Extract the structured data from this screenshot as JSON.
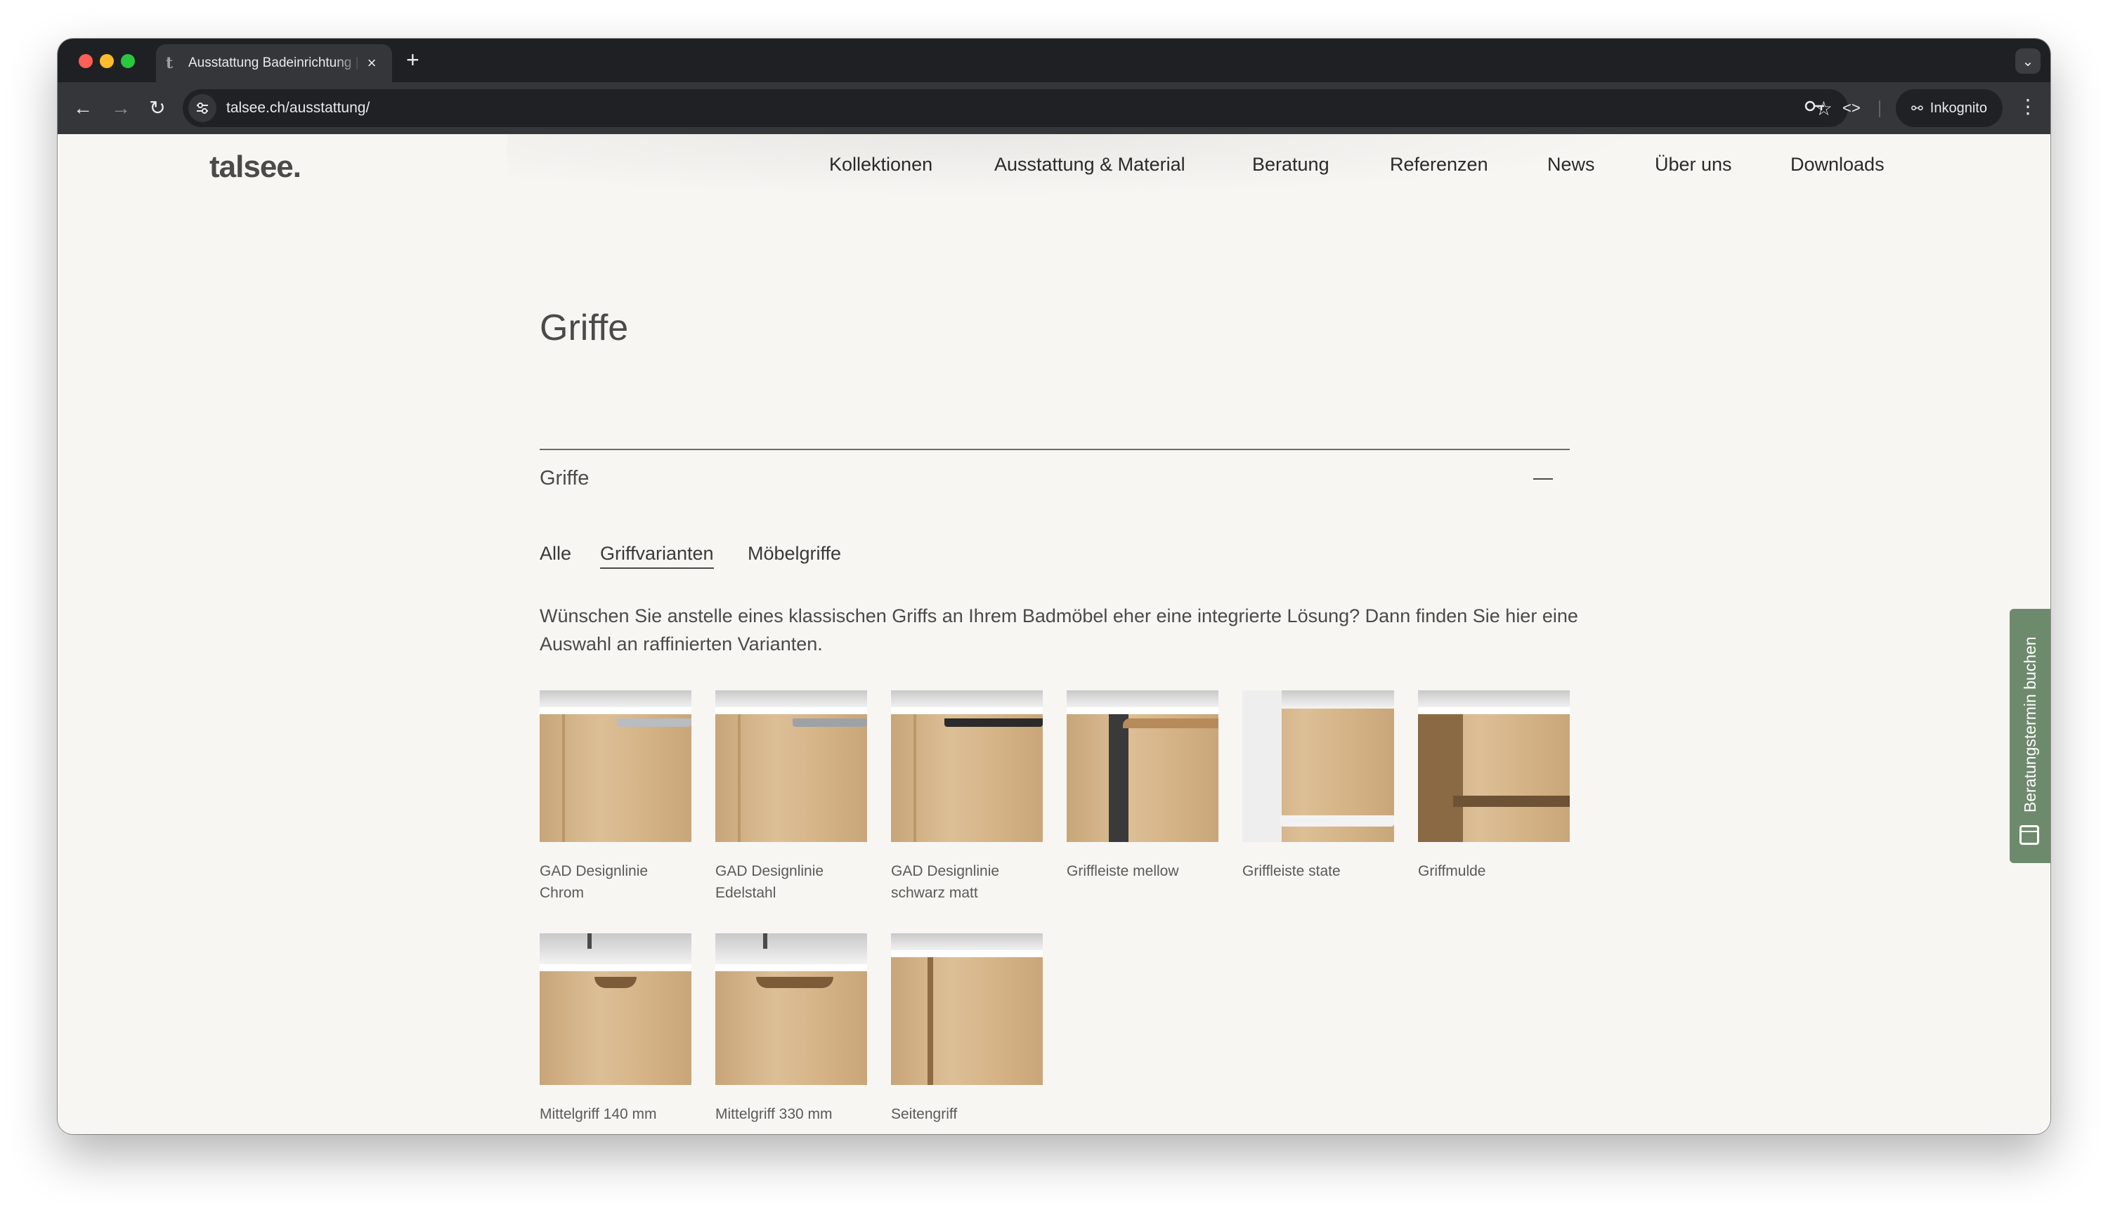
{
  "browser": {
    "tab_title": "Ausstattung Badeinrichtung |",
    "tab_favicon": "t",
    "new_tab_icon": "+",
    "close_icon": "×",
    "url": "talsee.ch/ausstattung/",
    "incognito_label": "Inkognito"
  },
  "site": {
    "logo": "talsee.",
    "nav": [
      "Kollektionen",
      "Ausstattung & Material",
      "Beratung",
      "Referenzen",
      "News",
      "Über uns",
      "Downloads"
    ]
  },
  "main": {
    "heading": "Griffe",
    "accordion_title": "Griffe",
    "filters": [
      {
        "label": "Alle",
        "active": false
      },
      {
        "label": "Griffvarianten",
        "active": true
      },
      {
        "label": "Möbelgriffe",
        "active": false
      }
    ],
    "description": "Wünschen Sie anstelle eines klassischen Griffs an Ihrem Badmöbel eher eine integrierte Lösung? Dann finden Sie hier eine Auswahl an raffinierten Varianten.",
    "products": [
      {
        "name": "GAD Designlinie Chrom",
        "variant": "chrom"
      },
      {
        "name": "GAD Designlinie Edelstahl",
        "variant": "steel"
      },
      {
        "name": "GAD Designlinie schwarz matt",
        "variant": "black"
      },
      {
        "name": "Griffleiste mellow",
        "variant": "mellow"
      },
      {
        "name": "Griffleiste state",
        "variant": "state"
      },
      {
        "name": "Griffmulde",
        "variant": "mulde"
      },
      {
        "name": "Mittelgriff 140 mm",
        "variant": "mittel140"
      },
      {
        "name": "Mittelgriff 330 mm",
        "variant": "mittel330"
      },
      {
        "name": "Seitengriff",
        "variant": "seiten"
      }
    ]
  },
  "cta": {
    "label": "Beratungstermin buchen",
    "icon": "calendar-icon"
  }
}
